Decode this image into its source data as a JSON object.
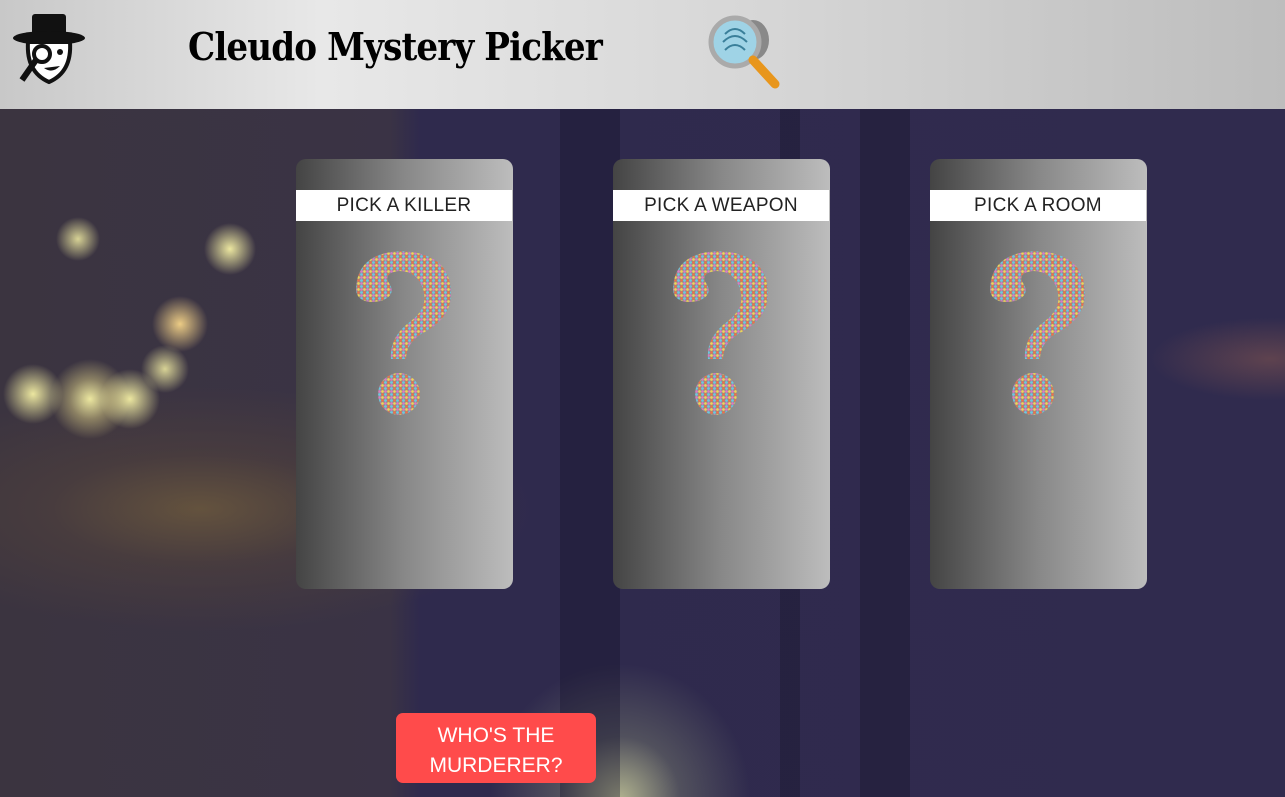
{
  "header": {
    "title": "Cleudo Mystery Picker",
    "logo_icon": "detective-icon",
    "search_icon": "magnifier-fingerprint-icon"
  },
  "cards": [
    {
      "label": "PICK A KILLER",
      "icon": "question-mark-icon"
    },
    {
      "label": "PICK A WEAPON",
      "icon": "question-mark-icon"
    },
    {
      "label": "PICK A ROOM",
      "icon": "question-mark-icon"
    }
  ],
  "action": {
    "label": "WHO'S THE MURDERER?",
    "color": "#ff4b4b"
  }
}
